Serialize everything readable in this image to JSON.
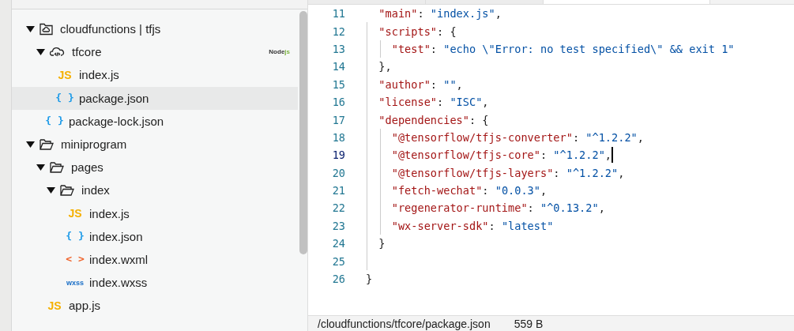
{
  "editor_tabs": [
    {
      "selected": false
    },
    {
      "selected": false
    },
    {
      "selected": true
    }
  ],
  "file_tree": [
    {
      "kind": "cloud-root",
      "label": "cloudfunctions | tfjs",
      "expanded": true,
      "selected": false,
      "children": [
        {
          "kind": "cloud-folder",
          "label": "tfcore",
          "expanded": true,
          "selected": false,
          "badge_parts": [
            "Node",
            "js"
          ],
          "children": [
            {
              "kind": "js",
              "icon_label": "JS",
              "label": "index.js",
              "selected": false
            },
            {
              "kind": "json",
              "icon_label": "{ }",
              "label": "package.json",
              "selected": true
            }
          ]
        },
        {
          "kind": "json",
          "icon_label": "{ }",
          "label": "package-lock.json",
          "selected": false
        }
      ]
    },
    {
      "kind": "folder",
      "label": "miniprogram",
      "expanded": true,
      "selected": false,
      "children": [
        {
          "kind": "folder",
          "label": "pages",
          "expanded": true,
          "selected": false,
          "children": [
            {
              "kind": "folder",
              "label": "index",
              "expanded": true,
              "selected": false,
              "children": [
                {
                  "kind": "js",
                  "icon_label": "JS",
                  "label": "index.js",
                  "selected": false
                },
                {
                  "kind": "json",
                  "icon_label": "{ }",
                  "label": "index.json",
                  "selected": false
                },
                {
                  "kind": "wxml",
                  "icon_label": "< >",
                  "label": "index.wxml",
                  "selected": false
                },
                {
                  "kind": "wxss",
                  "icon_label": "wxss",
                  "label": "index.wxss",
                  "selected": false
                }
              ]
            }
          ]
        },
        {
          "kind": "js",
          "icon_label": "JS",
          "label": "app.js",
          "selected": false
        }
      ]
    }
  ],
  "code_lines": [
    {
      "number": "11",
      "current": false,
      "tokens": [
        {
          "kind": "key",
          "text": "  \"main\""
        },
        {
          "kind": "punct",
          "text": ": "
        },
        {
          "kind": "string",
          "text": "\"index.js\""
        },
        {
          "kind": "punct",
          "text": ","
        }
      ]
    },
    {
      "number": "12",
      "current": false,
      "tokens": [
        {
          "kind": "key",
          "text": "  \"scripts\""
        },
        {
          "kind": "punct",
          "text": ": {"
        }
      ]
    },
    {
      "number": "13",
      "current": false,
      "tokens": [
        {
          "kind": "key",
          "text": "    \"test\""
        },
        {
          "kind": "punct",
          "text": ": "
        },
        {
          "kind": "string",
          "text": "\"echo \\\"Error: no test specified\\\" && exit 1\""
        }
      ]
    },
    {
      "number": "14",
      "current": false,
      "tokens": [
        {
          "kind": "punct",
          "text": "  },"
        }
      ]
    },
    {
      "number": "15",
      "current": false,
      "tokens": [
        {
          "kind": "key",
          "text": "  \"author\""
        },
        {
          "kind": "punct",
          "text": ": "
        },
        {
          "kind": "string",
          "text": "\"\""
        },
        {
          "kind": "punct",
          "text": ","
        }
      ]
    },
    {
      "number": "16",
      "current": false,
      "tokens": [
        {
          "kind": "key",
          "text": "  \"license\""
        },
        {
          "kind": "punct",
          "text": ": "
        },
        {
          "kind": "string",
          "text": "\"ISC\""
        },
        {
          "kind": "punct",
          "text": ","
        }
      ]
    },
    {
      "number": "17",
      "current": false,
      "tokens": [
        {
          "kind": "key",
          "text": "  \"dependencies\""
        },
        {
          "kind": "punct",
          "text": ": {"
        }
      ]
    },
    {
      "number": "18",
      "current": false,
      "tokens": [
        {
          "kind": "key",
          "text": "    \"@tensorflow/tfjs-converter\""
        },
        {
          "kind": "punct",
          "text": ": "
        },
        {
          "kind": "string",
          "text": "\"^1.2.2\""
        },
        {
          "kind": "punct",
          "text": ","
        }
      ]
    },
    {
      "number": "19",
      "current": true,
      "tokens": [
        {
          "kind": "key",
          "text": "    \"@tensorflow/tfjs-core\""
        },
        {
          "kind": "punct",
          "text": ": "
        },
        {
          "kind": "string",
          "text": "\"^1.2.2\""
        },
        {
          "kind": "punct",
          "text": ","
        }
      ]
    },
    {
      "number": "20",
      "current": false,
      "tokens": [
        {
          "kind": "key",
          "text": "    \"@tensorflow/tfjs-layers\""
        },
        {
          "kind": "punct",
          "text": ": "
        },
        {
          "kind": "string",
          "text": "\"^1.2.2\""
        },
        {
          "kind": "punct",
          "text": ","
        }
      ]
    },
    {
      "number": "21",
      "current": false,
      "tokens": [
        {
          "kind": "key",
          "text": "    \"fetch-wechat\""
        },
        {
          "kind": "punct",
          "text": ": "
        },
        {
          "kind": "string",
          "text": "\"0.0.3\""
        },
        {
          "kind": "punct",
          "text": ","
        }
      ]
    },
    {
      "number": "22",
      "current": false,
      "tokens": [
        {
          "kind": "key",
          "text": "    \"regenerator-runtime\""
        },
        {
          "kind": "punct",
          "text": ": "
        },
        {
          "kind": "string",
          "text": "\"^0.13.2\""
        },
        {
          "kind": "punct",
          "text": ","
        }
      ]
    },
    {
      "number": "23",
      "current": false,
      "tokens": [
        {
          "kind": "key",
          "text": "    \"wx-server-sdk\""
        },
        {
          "kind": "punct",
          "text": ": "
        },
        {
          "kind": "string",
          "text": "\"latest\""
        }
      ]
    },
    {
      "number": "24",
      "current": false,
      "tokens": [
        {
          "kind": "punct",
          "text": "  }"
        }
      ]
    },
    {
      "number": "25",
      "current": false
    },
    {
      "number": "26",
      "current": false,
      "tokens": [
        {
          "kind": "punct",
          "text": "}"
        }
      ]
    }
  ],
  "status_bar": {
    "path": "/cloudfunctions/tfcore/package.json",
    "size": "559 B"
  }
}
